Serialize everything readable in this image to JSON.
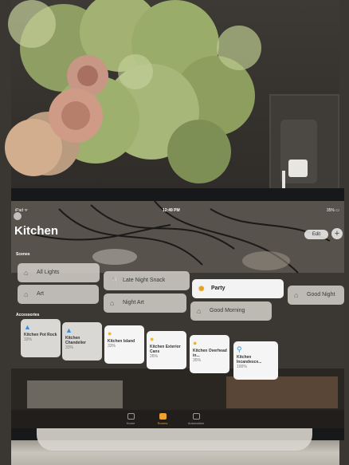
{
  "status": {
    "left": "iPad ᯤ",
    "time": "12:49 PM",
    "right": "35% ▭"
  },
  "title": "Kitchen",
  "edit_label": "Edit",
  "add_label": "+",
  "scenes_label": "Scenes",
  "scenes": [
    {
      "label": "All Lights",
      "icon": "house-icon",
      "active": false
    },
    {
      "label": "Late Night Snack",
      "icon": "fork-knife-icon",
      "active": false
    },
    {
      "label": "Party",
      "icon": "party-popper-icon",
      "active": true
    },
    {
      "label": "Good Night",
      "icon": "house-moon-icon",
      "active": false
    },
    {
      "label": "Art",
      "icon": "house-icon",
      "active": false
    },
    {
      "label": "Night Art",
      "icon": "house-icon",
      "active": false
    },
    {
      "label": "Good Morning",
      "icon": "house-sun-icon",
      "active": false
    }
  ],
  "accessories_label": "Accessories",
  "accessories": [
    {
      "name": "Kitchen Pot Rock",
      "status": "33%",
      "icon": "pendant-lamp-icon",
      "color": "#3a8fd8"
    },
    {
      "name": "Kitchen Chandelier",
      "status": "33%",
      "icon": "pendant-lamp-icon",
      "color": "#3a8fd8"
    },
    {
      "name": "Kitchen Island",
      "status": "33%",
      "icon": "bulb-icon",
      "color": "#f2b81c"
    },
    {
      "name": "Kitchen Exterior Cans",
      "status": "26%",
      "icon": "bulb-icon",
      "color": "#f2b81c"
    },
    {
      "name": "Kitchen Overhead in...",
      "status": "35%",
      "icon": "bulb-icon",
      "color": "#f2b81c"
    },
    {
      "name": "Kitchen Incandesce...",
      "status": "100%",
      "icon": "desk-lamp-icon",
      "color": "#3a8fd8"
    }
  ],
  "tabs": [
    {
      "label": "Home",
      "active": false
    },
    {
      "label": "Rooms",
      "active": true
    },
    {
      "label": "Automation",
      "active": false
    }
  ]
}
